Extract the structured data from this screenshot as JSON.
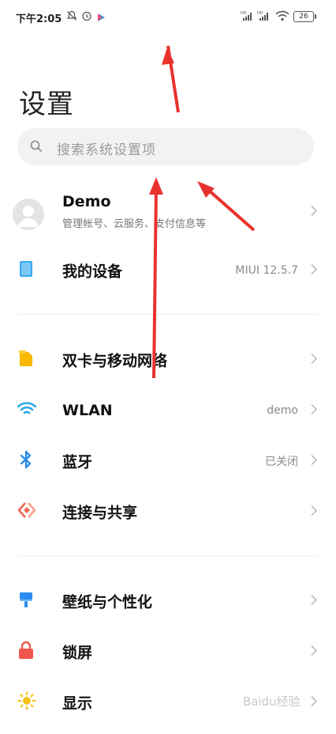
{
  "status_bar": {
    "time": "下午2:05",
    "battery": "26"
  },
  "page": {
    "title": "设置",
    "search_placeholder": "搜索系统设置项"
  },
  "account": {
    "name": "Demo",
    "subtitle": "管理帐号、云服务、支付信息等"
  },
  "items": [
    {
      "label": "我的设备",
      "value": "MIUI 12.5.7",
      "icon": "device-icon",
      "color": "#3aa8f0"
    },
    {
      "label": "双卡与移动网络",
      "value": "",
      "icon": "sim-icon",
      "color": "#f7b900"
    },
    {
      "label": "WLAN",
      "value": "demo",
      "icon": "wifi-icon",
      "color": "#2fa8e8"
    },
    {
      "label": "蓝牙",
      "value": "已关闭",
      "icon": "bluetooth-icon",
      "color": "#2a8ce8"
    },
    {
      "label": "连接与共享",
      "value": "",
      "icon": "connection-sharing-icon",
      "color": "#f06a4e"
    },
    {
      "label": "壁纸与个性化",
      "value": "",
      "icon": "wallpaper-icon",
      "color": "#2d8cf0"
    },
    {
      "label": "锁屏",
      "value": "",
      "icon": "lock-icon",
      "color": "#f0564e"
    },
    {
      "label": "显示",
      "value": "",
      "icon": "brightness-icon",
      "color": "#f7c21a"
    }
  ],
  "watermark": "Baidu经验",
  "annotation_color": "#e8322e"
}
